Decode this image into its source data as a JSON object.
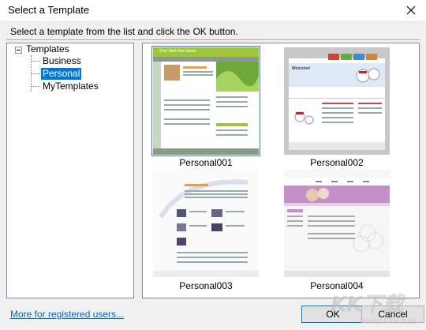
{
  "window": {
    "title": "Select a Template"
  },
  "instruction": "Select a template from the list and click the OK button.",
  "tree": {
    "root": "Templates",
    "items": [
      "Business",
      "Personal",
      "MyTemplates"
    ],
    "selected": "Personal"
  },
  "thumbnails": [
    {
      "caption": "Personal001",
      "selected": true,
      "header_text": "Your Web Site Name"
    },
    {
      "caption": "Personal002",
      "selected": false,
      "header_text": "Welcome!"
    },
    {
      "caption": "Personal003",
      "selected": false
    },
    {
      "caption": "Personal004",
      "selected": false
    }
  ],
  "footer": {
    "link": "More for registered users...",
    "ok": "OK",
    "cancel": "Cancel"
  },
  "watermark": {
    "text": "KK下载",
    "url": "www.kkx.net"
  },
  "colors": {
    "selection": "#0078d7",
    "link": "#0066cc",
    "thumb_green": "#9fc63a",
    "thumb_pink": "#c58fc9"
  }
}
